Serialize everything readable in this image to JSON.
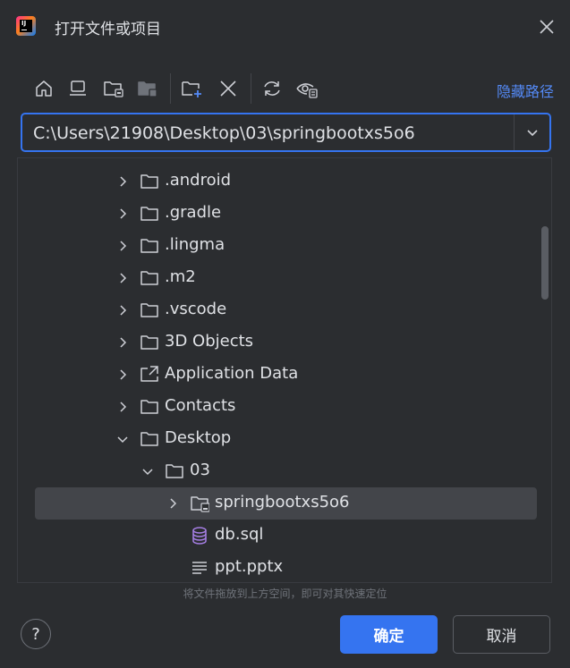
{
  "window": {
    "title": "打开文件或项目"
  },
  "toolbar": {
    "hide_path_label": "隐藏路径",
    "icons": [
      "home-icon",
      "desktop-icon",
      "project-folder-icon",
      "module-folder-icon",
      "new-folder-icon",
      "delete-icon",
      "refresh-icon",
      "show-hidden-icon"
    ]
  },
  "path": {
    "value": "C:\\Users\\21908\\Desktop\\03\\springbootxs5o6"
  },
  "tree": {
    "items": [
      {
        "label": ".android",
        "type": "folder",
        "expanded": false
      },
      {
        "label": ".gradle",
        "type": "folder",
        "expanded": false
      },
      {
        "label": ".lingma",
        "type": "folder",
        "expanded": false
      },
      {
        "label": ".m2",
        "type": "folder",
        "expanded": false
      },
      {
        "label": ".vscode",
        "type": "folder",
        "expanded": false
      },
      {
        "label": "3D Objects",
        "type": "folder",
        "expanded": false
      },
      {
        "label": "Application Data",
        "type": "folder-link",
        "expanded": false
      },
      {
        "label": "Contacts",
        "type": "folder",
        "expanded": false
      },
      {
        "label": "Desktop",
        "type": "folder",
        "expanded": true
      },
      {
        "label": "03",
        "type": "folder",
        "expanded": true
      },
      {
        "label": "springbootxs5o6",
        "type": "project-folder",
        "expanded": false,
        "selected": true
      },
      {
        "label": "db.sql",
        "type": "database-file"
      },
      {
        "label": "ppt.pptx",
        "type": "text-file"
      }
    ]
  },
  "footer": {
    "hint": "将文件拖放到上方空间，即可对其快速定位",
    "help_label": "?",
    "ok_label": "确定",
    "cancel_label": "取消"
  },
  "colors": {
    "background": "#2b2d30",
    "accent": "#3574f0",
    "link": "#548af7",
    "selection": "#43454a",
    "text": "#dfe1e5"
  }
}
